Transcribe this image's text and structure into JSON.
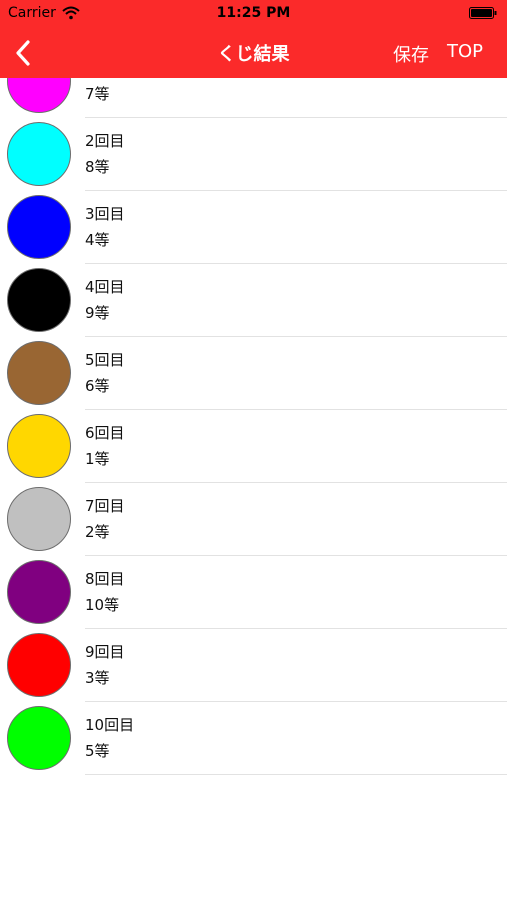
{
  "status_bar": {
    "carrier": "Carrier",
    "time": "11:25 PM"
  },
  "nav": {
    "title": "くじ結果",
    "save_label": "保存",
    "top_label": "TOP"
  },
  "results": [
    {
      "title": "",
      "rank": "7等",
      "color": "#ff00ff"
    },
    {
      "title": "2回目",
      "rank": "8等",
      "color": "#00ffff"
    },
    {
      "title": "3回目",
      "rank": "4等",
      "color": "#0000ff"
    },
    {
      "title": "4回目",
      "rank": "9等",
      "color": "#000000"
    },
    {
      "title": "5回目",
      "rank": "6等",
      "color": "#996633"
    },
    {
      "title": "6回目",
      "rank": "1等",
      "color": "#ffd700"
    },
    {
      "title": "7回目",
      "rank": "2等",
      "color": "#c0c0c0"
    },
    {
      "title": "8回目",
      "rank": "10等",
      "color": "#800080"
    },
    {
      "title": "9回目",
      "rank": "3等",
      "color": "#ff0000"
    },
    {
      "title": "10回目",
      "rank": "5等",
      "color": "#00ff00"
    }
  ]
}
